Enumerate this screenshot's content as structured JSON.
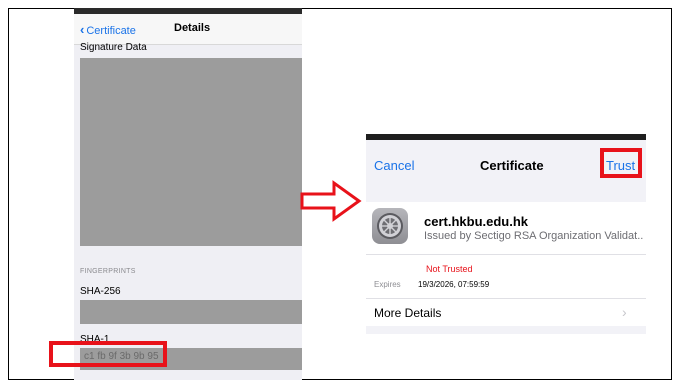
{
  "left": {
    "back_label": "Certificate",
    "title": "Details",
    "signature_label": "Signature Data",
    "fingerprints_header": "FINGERPRINTS",
    "sha256_label": "SHA-256",
    "sha1_label": "SHA-1",
    "sha1_value": "c1 fb 9f 3b 9b 95"
  },
  "right": {
    "cancel_label": "Cancel",
    "title": "Certificate",
    "trust_label": "Trust",
    "cert_name": "cert.hkbu.edu.hk",
    "issuer": "Issued by Sectigo RSA Organization Validat...",
    "status": "Not Trusted",
    "expires_label": "Expires",
    "expires_value": "19/3/2026, 07:59:59",
    "more_details_label": "More Details"
  },
  "colors": {
    "highlight": "#e8121a",
    "link": "#1a73e8",
    "not_trusted": "#e8121a"
  }
}
